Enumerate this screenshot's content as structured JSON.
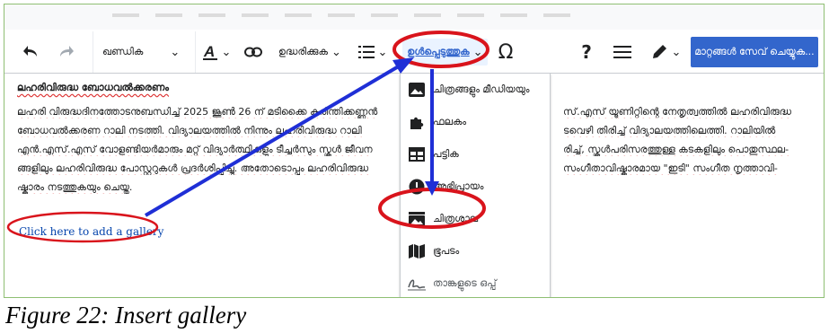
{
  "toolbar": {
    "format_label": "ഖണ്ഡിക",
    "cite_label": "ഉദ്ധരിക്കുക",
    "insert_label": "ഉൾപ്പെടുത്തുക",
    "special_char_symbol": "Ω",
    "help_symbol": "?",
    "save_label": "മാറ്റങ്ങൾ സേവ് ചെയ്യുക..."
  },
  "content": {
    "heading": "ലഹരിവിരുദ്ധ ബോധവൽക്കരണം",
    "lines": [
      "ലഹരി വിരുദ്ധദിനത്തോടനുബന്ധിച്ച് 2025 ജൂൺ 26 ന് മടിക്കൈ കരിന്തിക്കണ്ണൻ",
      "ബോധവൽക്കരണ റാലി നടത്തി. വിദ്യാലയത്തിൽ നിന്നും ലഹരിവിരുദ്ധ റാലി",
      "എൻ.എസ്.എസ് വോളണ്ടിയർമാരും മറ്റ് വിദ്യാർത്ഥികളും ടീച്ചർസും സ്കൂൾ ജീവന",
      "ങ്ങളിലും ലഹരിവിരുദ്ധ പോസ്റ്ററുകൾ പ്രദർശിപ്പിച്ചു. അതോടൊപ്പം ലഹരിവിരുദ്ധ",
      "ഷ്കാരം നടത്തുകയും ചെയ്തു."
    ],
    "right_fragments": [
      "സ്.എസ് യൂണിറ്റിന്റെ നേതൃത്വത്തിൽ ലഹരിവിരുദ്ധ",
      "ടവെഴി തിരിച്ച് വിദ്യാലയത്തിലെത്തി. റാലിയിൽ",
      "രിച്ച്, സ്കൂൾപരിസരത്തുള്ള കടകളിലും പൊതുസ്ഥല-",
      "സംഗീതാവിഷ്കാരമായ \"ഇടി\" സംഗീത നൃത്താവി-"
    ]
  },
  "gallery_link": "Click here to add a gallery",
  "insert_menu": {
    "items": [
      {
        "label": "ചിത്രങ്ങളും മീഡിയയും",
        "icon": "image-icon"
      },
      {
        "label": "ഫലകം",
        "icon": "puzzle-icon"
      },
      {
        "label": "പട്ടിക",
        "icon": "table-icon"
      },
      {
        "label": "അഭിപ്രായം",
        "icon": "comment-icon"
      },
      {
        "label": "ചിത്രശാല",
        "icon": "gallery-icon"
      },
      {
        "label": "ഭൂപടം",
        "icon": "map-icon"
      },
      {
        "label": "താങ്കളുടെ ഒപ്പ്",
        "icon": "signature-icon"
      }
    ]
  },
  "caption": "Figure 22: Insert gallery",
  "colors": {
    "accent": "#3366cc",
    "annotation": "#d9141c",
    "arrow": "#1f2fd6",
    "frame_border": "#8fbf73"
  }
}
